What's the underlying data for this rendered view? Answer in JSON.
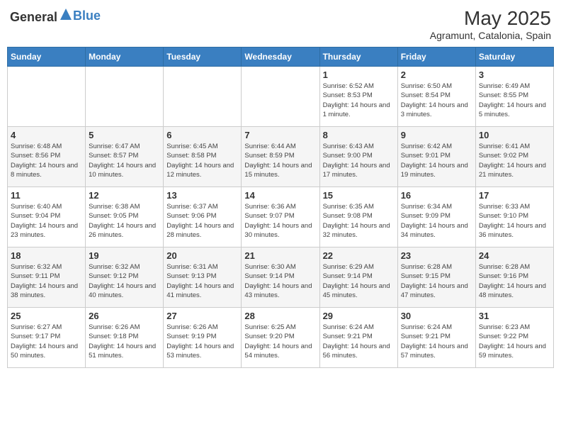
{
  "header": {
    "logo_general": "General",
    "logo_blue": "Blue",
    "month_year": "May 2025",
    "location": "Agramunt, Catalonia, Spain"
  },
  "days_of_week": [
    "Sunday",
    "Monday",
    "Tuesday",
    "Wednesday",
    "Thursday",
    "Friday",
    "Saturday"
  ],
  "weeks": [
    [
      {
        "day": "",
        "info": ""
      },
      {
        "day": "",
        "info": ""
      },
      {
        "day": "",
        "info": ""
      },
      {
        "day": "",
        "info": ""
      },
      {
        "day": "1",
        "info": "Sunrise: 6:52 AM\nSunset: 8:53 PM\nDaylight: 14 hours and 1 minute."
      },
      {
        "day": "2",
        "info": "Sunrise: 6:50 AM\nSunset: 8:54 PM\nDaylight: 14 hours and 3 minutes."
      },
      {
        "day": "3",
        "info": "Sunrise: 6:49 AM\nSunset: 8:55 PM\nDaylight: 14 hours and 5 minutes."
      }
    ],
    [
      {
        "day": "4",
        "info": "Sunrise: 6:48 AM\nSunset: 8:56 PM\nDaylight: 14 hours and 8 minutes."
      },
      {
        "day": "5",
        "info": "Sunrise: 6:47 AM\nSunset: 8:57 PM\nDaylight: 14 hours and 10 minutes."
      },
      {
        "day": "6",
        "info": "Sunrise: 6:45 AM\nSunset: 8:58 PM\nDaylight: 14 hours and 12 minutes."
      },
      {
        "day": "7",
        "info": "Sunrise: 6:44 AM\nSunset: 8:59 PM\nDaylight: 14 hours and 15 minutes."
      },
      {
        "day": "8",
        "info": "Sunrise: 6:43 AM\nSunset: 9:00 PM\nDaylight: 14 hours and 17 minutes."
      },
      {
        "day": "9",
        "info": "Sunrise: 6:42 AM\nSunset: 9:01 PM\nDaylight: 14 hours and 19 minutes."
      },
      {
        "day": "10",
        "info": "Sunrise: 6:41 AM\nSunset: 9:02 PM\nDaylight: 14 hours and 21 minutes."
      }
    ],
    [
      {
        "day": "11",
        "info": "Sunrise: 6:40 AM\nSunset: 9:04 PM\nDaylight: 14 hours and 23 minutes."
      },
      {
        "day": "12",
        "info": "Sunrise: 6:38 AM\nSunset: 9:05 PM\nDaylight: 14 hours and 26 minutes."
      },
      {
        "day": "13",
        "info": "Sunrise: 6:37 AM\nSunset: 9:06 PM\nDaylight: 14 hours and 28 minutes."
      },
      {
        "day": "14",
        "info": "Sunrise: 6:36 AM\nSunset: 9:07 PM\nDaylight: 14 hours and 30 minutes."
      },
      {
        "day": "15",
        "info": "Sunrise: 6:35 AM\nSunset: 9:08 PM\nDaylight: 14 hours and 32 minutes."
      },
      {
        "day": "16",
        "info": "Sunrise: 6:34 AM\nSunset: 9:09 PM\nDaylight: 14 hours and 34 minutes."
      },
      {
        "day": "17",
        "info": "Sunrise: 6:33 AM\nSunset: 9:10 PM\nDaylight: 14 hours and 36 minutes."
      }
    ],
    [
      {
        "day": "18",
        "info": "Sunrise: 6:32 AM\nSunset: 9:11 PM\nDaylight: 14 hours and 38 minutes."
      },
      {
        "day": "19",
        "info": "Sunrise: 6:32 AM\nSunset: 9:12 PM\nDaylight: 14 hours and 40 minutes."
      },
      {
        "day": "20",
        "info": "Sunrise: 6:31 AM\nSunset: 9:13 PM\nDaylight: 14 hours and 41 minutes."
      },
      {
        "day": "21",
        "info": "Sunrise: 6:30 AM\nSunset: 9:14 PM\nDaylight: 14 hours and 43 minutes."
      },
      {
        "day": "22",
        "info": "Sunrise: 6:29 AM\nSunset: 9:14 PM\nDaylight: 14 hours and 45 minutes."
      },
      {
        "day": "23",
        "info": "Sunrise: 6:28 AM\nSunset: 9:15 PM\nDaylight: 14 hours and 47 minutes."
      },
      {
        "day": "24",
        "info": "Sunrise: 6:28 AM\nSunset: 9:16 PM\nDaylight: 14 hours and 48 minutes."
      }
    ],
    [
      {
        "day": "25",
        "info": "Sunrise: 6:27 AM\nSunset: 9:17 PM\nDaylight: 14 hours and 50 minutes."
      },
      {
        "day": "26",
        "info": "Sunrise: 6:26 AM\nSunset: 9:18 PM\nDaylight: 14 hours and 51 minutes."
      },
      {
        "day": "27",
        "info": "Sunrise: 6:26 AM\nSunset: 9:19 PM\nDaylight: 14 hours and 53 minutes."
      },
      {
        "day": "28",
        "info": "Sunrise: 6:25 AM\nSunset: 9:20 PM\nDaylight: 14 hours and 54 minutes."
      },
      {
        "day": "29",
        "info": "Sunrise: 6:24 AM\nSunset: 9:21 PM\nDaylight: 14 hours and 56 minutes."
      },
      {
        "day": "30",
        "info": "Sunrise: 6:24 AM\nSunset: 9:21 PM\nDaylight: 14 hours and 57 minutes."
      },
      {
        "day": "31",
        "info": "Sunrise: 6:23 AM\nSunset: 9:22 PM\nDaylight: 14 hours and 59 minutes."
      }
    ]
  ]
}
